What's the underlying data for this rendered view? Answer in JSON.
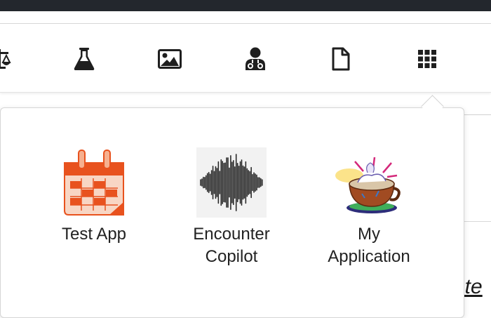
{
  "toolbar": {
    "items": [
      {
        "name": "scale-icon"
      },
      {
        "name": "flask-icon"
      },
      {
        "name": "image-icon"
      },
      {
        "name": "doctor-icon"
      },
      {
        "name": "document-icon"
      },
      {
        "name": "apps-grid-icon"
      }
    ]
  },
  "apps": [
    {
      "label": "Test App",
      "icon": "calendar-icon"
    },
    {
      "label": "Encounter\nCopilot",
      "icon": "waveform-icon"
    },
    {
      "label": "My\nApplication",
      "icon": "coffee-cup-icon"
    }
  ],
  "background": {
    "partial_text": "ote"
  },
  "colors": {
    "topbar": "#23272d",
    "icon": "#1f1f1f",
    "calendar": "#e8521e"
  }
}
